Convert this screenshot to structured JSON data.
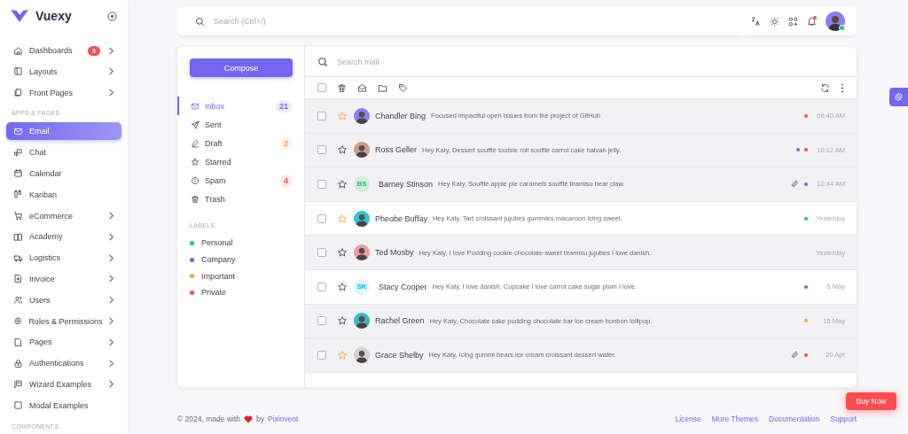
{
  "brand": {
    "name": "Vuexy"
  },
  "sidebar": {
    "items": [
      {
        "kind": "item",
        "label": "Dashboards",
        "selected": false,
        "badge": "5",
        "chevron": true
      },
      {
        "kind": "item",
        "label": "Layouts",
        "selected": false,
        "chevron": true
      },
      {
        "kind": "item",
        "label": "Front Pages",
        "selected": false,
        "chevron": true
      },
      {
        "kind": "header",
        "label": "APPS & PAGES"
      },
      {
        "kind": "item",
        "label": "Email",
        "selected": true,
        "chevron": false
      },
      {
        "kind": "item",
        "label": "Chat",
        "selected": false,
        "chevron": false
      },
      {
        "kind": "item",
        "label": "Calendar",
        "selected": false,
        "chevron": false
      },
      {
        "kind": "item",
        "label": "Kanban",
        "selected": false,
        "chevron": false
      },
      {
        "kind": "item",
        "label": "eCommerce",
        "selected": false,
        "chevron": true
      },
      {
        "kind": "item",
        "label": "Academy",
        "selected": false,
        "chevron": true
      },
      {
        "kind": "item",
        "label": "Logistics",
        "selected": false,
        "chevron": true
      },
      {
        "kind": "item",
        "label": "Invoice",
        "selected": false,
        "chevron": true
      },
      {
        "kind": "item",
        "label": "Users",
        "selected": false,
        "chevron": true
      },
      {
        "kind": "item",
        "label": "Roles & Permissions",
        "selected": false,
        "chevron": true
      },
      {
        "kind": "item",
        "label": "Pages",
        "selected": false,
        "chevron": true
      },
      {
        "kind": "item",
        "label": "Authentications",
        "selected": false,
        "chevron": true
      },
      {
        "kind": "item",
        "label": "Wizard Examples",
        "selected": false,
        "chevron": true
      },
      {
        "kind": "item",
        "label": "Modal Examples",
        "selected": false,
        "chevron": false
      },
      {
        "kind": "header",
        "label": "COMPONENTS"
      }
    ]
  },
  "navbar": {
    "search": {
      "placeholder": "Search (Ctrl+/)"
    },
    "has_notifications": true,
    "user": {
      "online": true
    }
  },
  "email": {
    "compose": "Compose",
    "folders": [
      {
        "label": "Inbox",
        "selected": true,
        "count": "21",
        "color": "#7367f0"
      },
      {
        "label": "Sent",
        "selected": false
      },
      {
        "label": "Draft",
        "selected": false,
        "count": "2",
        "color": "#ff9f43"
      },
      {
        "label": "Starred",
        "selected": false
      },
      {
        "label": "Spam",
        "selected": false,
        "count": "4",
        "color": "#ea5455"
      },
      {
        "label": "Trash",
        "selected": false
      }
    ],
    "labels_heading": "LABELS",
    "labels": [
      {
        "label": "Personal",
        "color": "#28c76f"
      },
      {
        "label": "Company",
        "color": "#7367f0"
      },
      {
        "label": "Important",
        "color": "#ff9f43"
      },
      {
        "label": "Private",
        "color": "#ea5455"
      }
    ],
    "search": {
      "placeholder": "Search mail"
    },
    "select_all": {
      "checked": false
    },
    "rows": [
      {
        "sender": "Chandler Bing",
        "preview": "Focused impactful open issues from the project of GitHub",
        "time": "08:40 AM",
        "starred": true,
        "read": true,
        "attachment": false,
        "avatar": {
          "kind": "photo",
          "color": "#8c7ff5"
        },
        "labels": [
          {
            "color": "#ea5455"
          }
        ]
      },
      {
        "sender": "Ross Geller",
        "preview": "Hey Katy, Dessert soufflé tootsie roll soufflé carrot cake halvah jelly.",
        "time": "10:12 AM",
        "starred": false,
        "read": true,
        "attachment": false,
        "avatar": {
          "kind": "photo",
          "color": "#c9a08a"
        },
        "labels": [
          {
            "color": "#7367f0"
          },
          {
            "color": "#ea5455"
          }
        ]
      },
      {
        "sender": "Barney Stinson",
        "preview": "Hey Katy, Soufflé apple pie caramels soufflé tiramisu bear claw.",
        "time": "12:44 AM",
        "starred": false,
        "read": true,
        "attachment": true,
        "avatar": {
          "kind": "initials",
          "initials": "BS",
          "color": "#28c76f"
        },
        "labels": [
          {
            "color": "#7367f0"
          }
        ]
      },
      {
        "sender": "Pheobe Buffay",
        "preview": "Hey Katy, Tart croissant jujubes gummies macaroon Icing sweet.",
        "time": "Yesterday",
        "starred": true,
        "read": false,
        "attachment": false,
        "avatar": {
          "kind": "photo",
          "color": "#2fc6d8"
        },
        "labels": [
          {
            "color": "#28c76f"
          }
        ]
      },
      {
        "sender": "Ted Mosby",
        "preview": "Hey Katy, I love Pudding cookie chocolate sweet tiramisu jujubes I love danish.",
        "time": "Yesterday",
        "starred": false,
        "read": true,
        "attachment": false,
        "avatar": {
          "kind": "photo",
          "color": "#e8a0a0"
        }
      },
      {
        "sender": "Stacy Cooper",
        "preview": "Hey Katy, I love danish. Cupcake I love carrot cake sugar plum I love.",
        "time": "5 May",
        "starred": false,
        "read": false,
        "attachment": false,
        "avatar": {
          "kind": "initials",
          "initials": "SK",
          "color": "#00bad1"
        },
        "labels": [
          {
            "color": "#7367f0"
          }
        ]
      },
      {
        "sender": "Rachel Green",
        "preview": "Hey Katy, Chocolate cake pudding chocolate bar ice cream bonbon lollipop.",
        "time": "15 May",
        "starred": false,
        "read": true,
        "attachment": false,
        "avatar": {
          "kind": "photo",
          "color": "#3ab7c9"
        },
        "labels": [
          {
            "color": "#ff9f43"
          }
        ]
      },
      {
        "sender": "Grace Shelby",
        "preview": "Hey Katy, Icing gummi bears ice cream croissant dessert wafer.",
        "time": "20 Apr",
        "starred": true,
        "read": true,
        "attachment": true,
        "avatar": {
          "kind": "photo",
          "color": "#d6d0d4"
        },
        "labels": [
          {
            "color": "#ea5455"
          }
        ]
      }
    ]
  },
  "footer": {
    "copyright": "© 2024, made with",
    "by": "by",
    "author": "Pixinvent",
    "links": [
      "License",
      "More Themes",
      "Documentation",
      "Support"
    ]
  },
  "buy_button": "Buy Now"
}
